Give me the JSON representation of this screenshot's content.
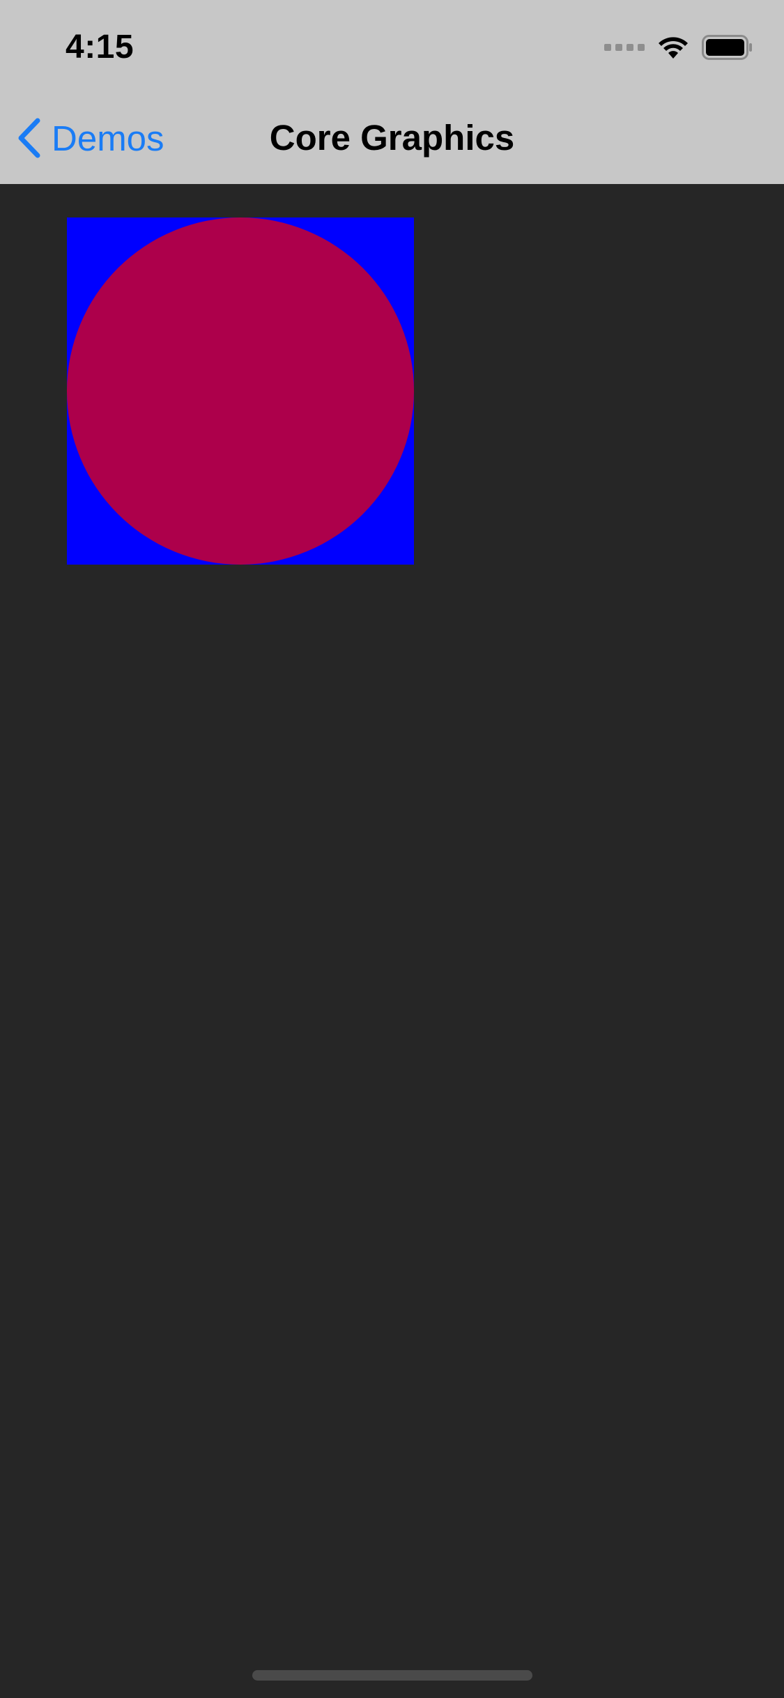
{
  "status_bar": {
    "time": "4:15",
    "wifi_icon": "wifi-icon",
    "battery_icon": "battery-icon",
    "signal_icon": "signal-dots-icon"
  },
  "nav_bar": {
    "back_label": "Demos",
    "back_icon": "chevron-left-icon",
    "title": "Core Graphics"
  },
  "drawing": {
    "background_color": "#0000ff",
    "circle_color": "#ad004b"
  },
  "colors": {
    "accent": "#1a7cf5",
    "chrome_bg": "#c7c7c7",
    "content_bg": "#262626"
  }
}
